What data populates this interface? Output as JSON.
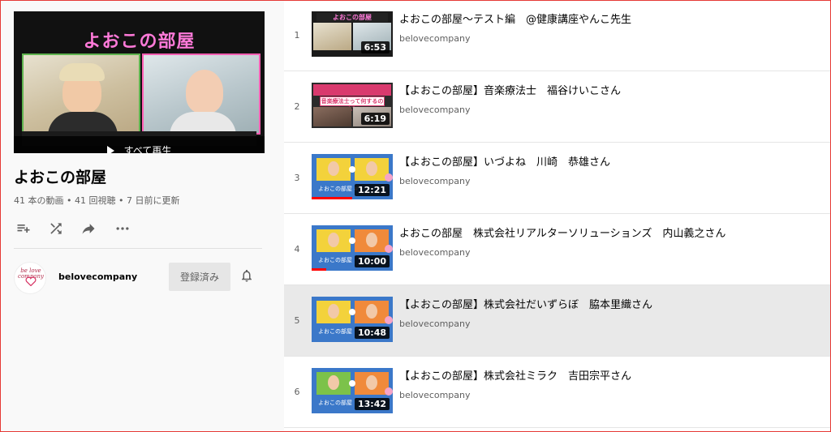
{
  "playlist": {
    "hero_banner_text": "よおこの部屋",
    "play_all_label": "すべて再生",
    "title": "よおこの部屋",
    "stats": "41 本の動画 • 41 回視聴 • 7 日前に更新",
    "actions": [
      {
        "icon": "add-to-queue-icon"
      },
      {
        "icon": "shuffle-icon"
      },
      {
        "icon": "share-icon"
      },
      {
        "icon": "more-icon"
      }
    ]
  },
  "owner": {
    "avatar_text": "be love company",
    "name": "belovecompany",
    "subscribe_label": "登録済み",
    "bell_icon": "bell-icon"
  },
  "videos": [
    {
      "index": "1",
      "title": "よおこの部屋～テスト編　@健康講座やんこ先生",
      "channel": "belovecompany",
      "duration": "6:53",
      "thumb_text": "よおこの部屋",
      "progress": 0
    },
    {
      "index": "2",
      "title": "【よおこの部屋】音楽療法士　福谷けいこさん",
      "channel": "belovecompany",
      "duration": "6:19",
      "thumb_text": "音楽療法士って何するのん？",
      "progress": 0
    },
    {
      "index": "3",
      "title": "【よおこの部屋】いづよね　川崎　恭雄さん",
      "channel": "belovecompany",
      "duration": "12:21",
      "thumb_text": "よおこの部屋 #",
      "progress": 0.5
    },
    {
      "index": "4",
      "title": "よおこの部屋　株式会社リアルターソリューションズ　内山義之さん",
      "channel": "belovecompany",
      "duration": "10:00",
      "thumb_text": "よおこの部屋",
      "progress": 0.18
    },
    {
      "index": "5",
      "title": "【よおこの部屋】株式会社だいずらぼ　脇本里織さん",
      "channel": "belovecompany",
      "duration": "10:48",
      "thumb_text": "よおこの部屋",
      "progress": 0
    },
    {
      "index": "6",
      "title": "【よおこの部屋】株式会社ミラク　吉田宗平さん",
      "channel": "belovecompany",
      "duration": "13:42",
      "thumb_text": "よおこの部屋",
      "progress": 0
    }
  ],
  "colors": {
    "accent_red": "#ff0000",
    "active_row": "#e9e9e9",
    "thumb_blue": "#3b78c9",
    "banner_pink": "#ff7ad9"
  }
}
